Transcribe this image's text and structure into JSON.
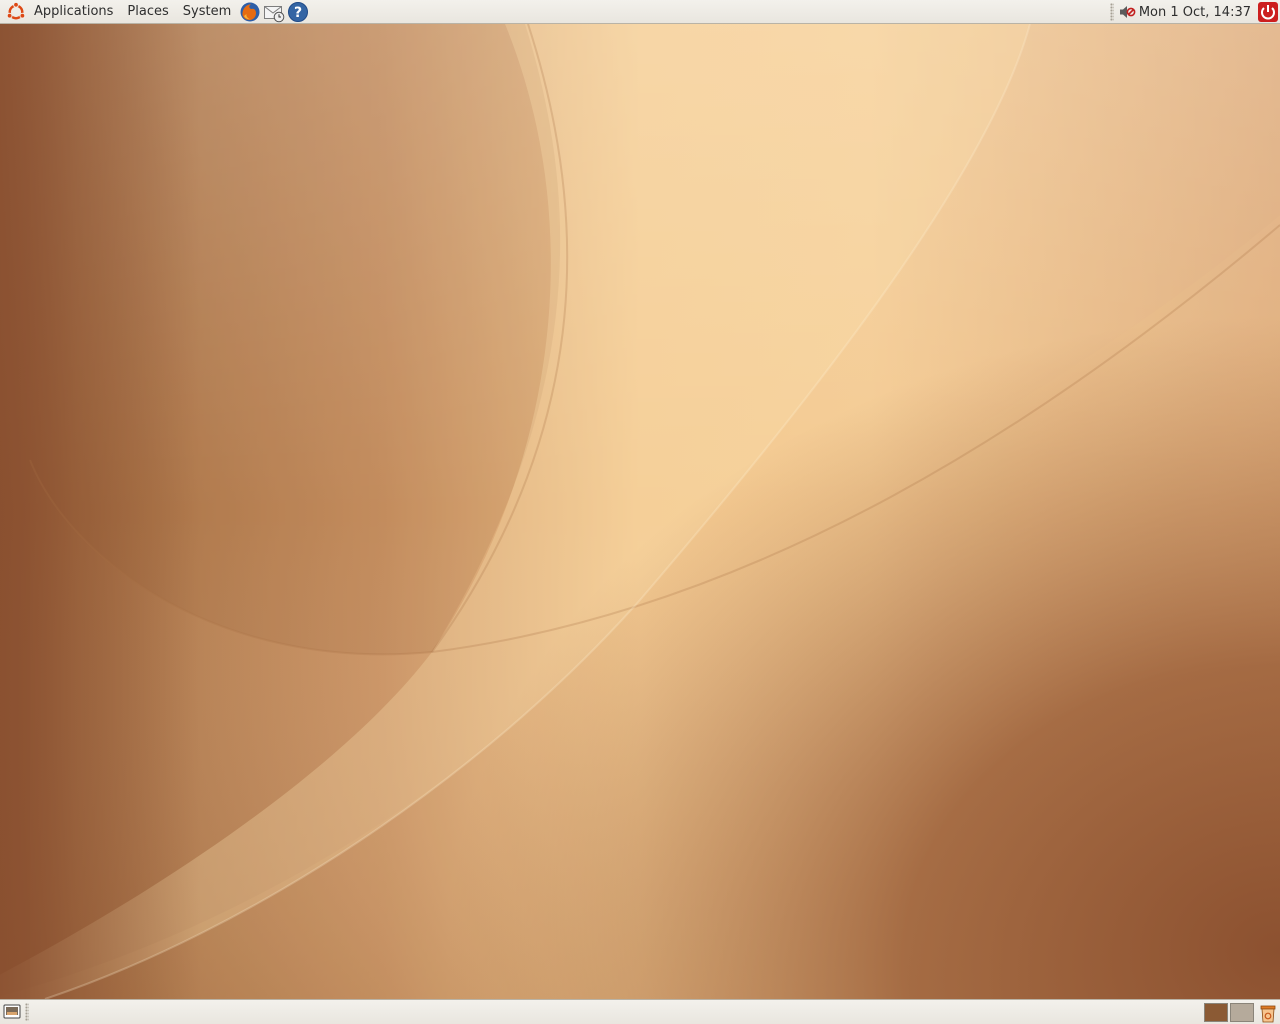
{
  "top_panel": {
    "menus": [
      "Applications",
      "Places",
      "System"
    ],
    "launchers": [
      "firefox-icon",
      "mail-icon",
      "help-icon"
    ],
    "tray": {
      "volume_icon": "volume-muted-icon",
      "clock": "Mon  1 Oct, 14:37",
      "power_icon": "power-icon"
    }
  },
  "bottom_panel": {
    "show_desktop_icon": "show-desktop-icon",
    "workspaces": [
      "workspace-1",
      "workspace-2"
    ],
    "trash_icon": "trash-icon"
  },
  "colors": {
    "panel_bg": "#ebe9e3",
    "wallpaper_dark": "#8f5532",
    "wallpaper_light": "#f9d5a0",
    "workspace_active": "#8b5a34",
    "workspace_inactive": "#b5aa9b",
    "power_red": "#cc1e1e"
  }
}
